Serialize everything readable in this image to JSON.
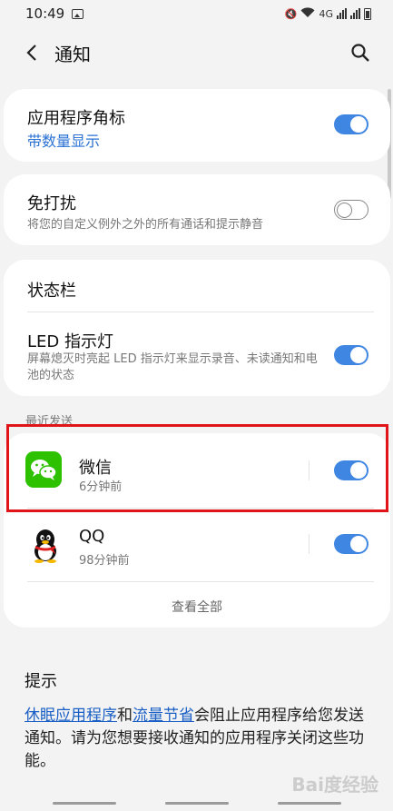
{
  "status_bar": {
    "time": "10:49",
    "network_label": "4G"
  },
  "header": {
    "title": "通知"
  },
  "badge_card": {
    "title": "应用程序角标",
    "subtitle": "带数量显示",
    "toggle_on": true
  },
  "dnd_card": {
    "title": "免打扰",
    "subtitle": "将您的自定义例外之外的所有通话和提示静音",
    "toggle_on": false
  },
  "status_card": {
    "header": "状态栏",
    "led_title": "LED 指示灯",
    "led_subtitle": "屏幕熄灭时亮起 LED 指示灯来显示录音、未读通知和电池的状态",
    "led_toggle_on": true
  },
  "recent": {
    "label": "最近发送",
    "apps": [
      {
        "name": "微信",
        "time": "6分钟前",
        "icon": "wechat-icon",
        "toggle_on": true
      },
      {
        "name": "QQ",
        "time": "98分钟前",
        "icon": "qq-penguin-icon",
        "toggle_on": true
      }
    ],
    "view_all": "查看全部"
  },
  "tips": {
    "title": "提示",
    "link1": "休眠应用程序",
    "conj": "和",
    "link2": "流量节省",
    "rest": "会阻止应用程序给您发送通知。请为您想要接收通知的应用程序关闭这些功能。"
  },
  "colors": {
    "accent": "#3f86e2",
    "highlight": "#e1141a",
    "wechat_green": "#2dc100"
  },
  "watermark": "Bai度经验"
}
